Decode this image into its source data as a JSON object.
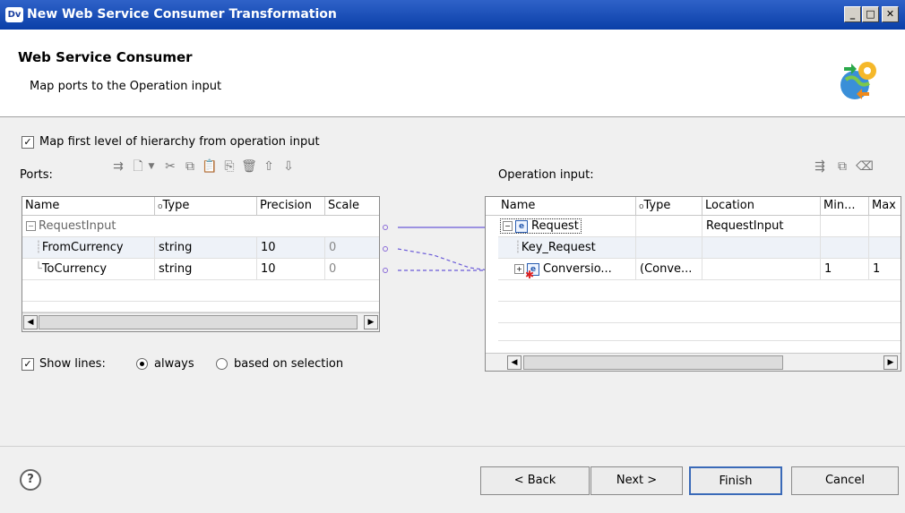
{
  "window": {
    "title": "New Web Service Consumer Transformation",
    "app_icon": "Dv"
  },
  "header": {
    "title": "Web Service Consumer",
    "subtitle": "Map ports to the Operation input"
  },
  "map_first_level": {
    "label": "Map first level of hierarchy from operation input",
    "checked": true
  },
  "ports": {
    "label": "Ports:",
    "columns": [
      "Name",
      "Type",
      "Precision",
      "Scale"
    ],
    "parent": "RequestInput",
    "rows": [
      {
        "name": "FromCurrency",
        "type": "string",
        "precision": "10",
        "scale": "0"
      },
      {
        "name": "ToCurrency",
        "type": "string",
        "precision": "10",
        "scale": "0"
      }
    ]
  },
  "operation_input": {
    "label": "Operation input:",
    "columns": [
      "Name",
      "Type",
      "Location",
      "Min...",
      "Max"
    ],
    "rows": [
      {
        "name": "Request",
        "type": "",
        "location": "RequestInput",
        "min": "",
        "max": ""
      },
      {
        "name": "Key_Request",
        "type": "",
        "location": "",
        "min": "",
        "max": ""
      },
      {
        "name": "Conversio...",
        "type": "(Conve...",
        "location": "",
        "min": "1",
        "max": "1"
      }
    ]
  },
  "show_lines": {
    "label": "Show lines:",
    "checked": true,
    "option_always": "always",
    "option_selection": "based on selection",
    "selected": "always"
  },
  "buttons": {
    "back": "< Back",
    "next": "Next >",
    "finish": "Finish",
    "cancel": "Cancel",
    "help": "?"
  }
}
